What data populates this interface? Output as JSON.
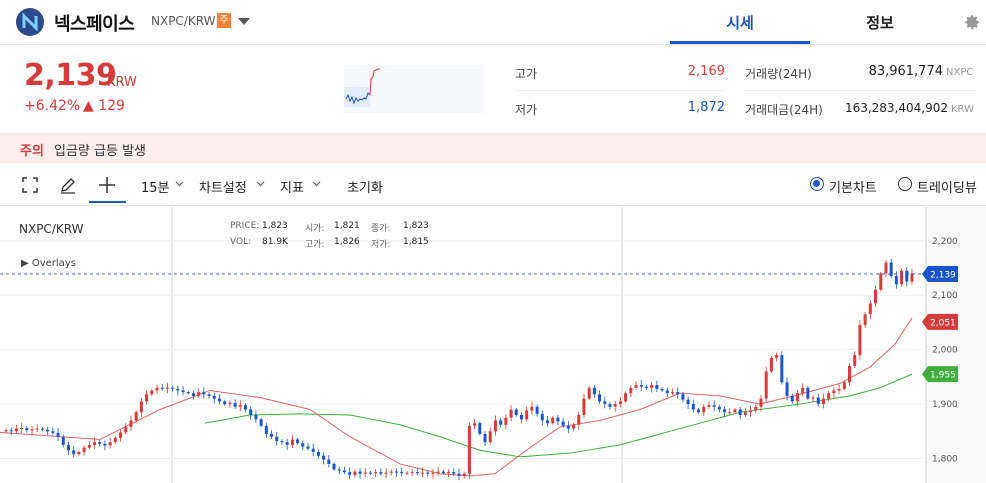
{
  "header": {
    "coin_name": "넥스페이스",
    "pair": "NXPC/KRW",
    "warning_badge": "주",
    "tabs": [
      {
        "label": "시세"
      },
      {
        "label": "정보"
      }
    ]
  },
  "summary": {
    "price": "2,139",
    "price_unit": "KRW",
    "change_pct": "+6.42%",
    "change_abs": "▲ 129",
    "high_label": "고가",
    "high_value": "2,169",
    "low_label": "저가",
    "low_value": "1,872",
    "volume_label": "거래량(24H)",
    "volume_value": "83,961,774",
    "volume_unit": "NXPC",
    "amount_label": "거래대금(24H)",
    "amount_value": "163,283,404,902",
    "amount_unit": "KRW"
  },
  "notice": {
    "tag": "주의",
    "text": "입금량 급등 발생"
  },
  "toolbar": {
    "interval": "15분",
    "chart_settings": "차트설정",
    "indicators": "지표",
    "reset": "초기화",
    "basic_chart": "기본차트",
    "tradingview": "트레이딩뷰"
  },
  "chart_info": {
    "pair": "NXPC/KRW",
    "overlays": "Overlays",
    "price_label": "PRICE:",
    "price": "1,823",
    "open_label": "시가:",
    "open": "1,821",
    "close_label": "종가:",
    "close": "1,823",
    "vol_label": "VOL:",
    "vol": "81.9K",
    "high_label": "고가:",
    "high": "1,826",
    "low_label": "저가:",
    "low": "1,815"
  },
  "chart_data": {
    "type": "candlestick",
    "y_ticks": [
      "2,200",
      "2,100",
      "2,000",
      "1,900",
      "1,800"
    ],
    "y_tick_values": [
      2200,
      2100,
      2000,
      1900,
      1800
    ],
    "ylim": [
      1755,
      2262
    ],
    "price_tags": [
      {
        "label": "2,139",
        "value": 2139,
        "color": "#1a55c9"
      },
      {
        "label": "2,051",
        "value": 2051,
        "color": "#d43b3b"
      },
      {
        "label": "1,955",
        "value": 1955,
        "color": "#3fae3f"
      }
    ],
    "closes": [
      1852,
      1850,
      1855,
      1856,
      1852,
      1854,
      1855,
      1853,
      1850,
      1847,
      1840,
      1825,
      1815,
      1808,
      1812,
      1820,
      1825,
      1830,
      1827,
      1824,
      1830,
      1838,
      1848,
      1858,
      1870,
      1885,
      1905,
      1918,
      1925,
      1930,
      1928,
      1930,
      1928,
      1925,
      1922,
      1920,
      1915,
      1922,
      1918,
      1915,
      1910,
      1905,
      1900,
      1902,
      1895,
      1898,
      1890,
      1880,
      1872,
      1860,
      1845,
      1840,
      1832,
      1830,
      1825,
      1835,
      1828,
      1822,
      1818,
      1812,
      1805,
      1798,
      1790,
      1780,
      1778,
      1775,
      1770,
      1776,
      1772,
      1774,
      1773,
      1775,
      1772,
      1774,
      1776,
      1775,
      1773,
      1774,
      1775,
      1773,
      1774,
      1772,
      1774,
      1776,
      1773,
      1775,
      1772,
      1768,
      1772,
      1860,
      1865,
      1845,
      1830,
      1850,
      1870,
      1862,
      1875,
      1890,
      1880,
      1872,
      1888,
      1895,
      1882,
      1870,
      1865,
      1875,
      1868,
      1860,
      1855,
      1862,
      1880,
      1910,
      1930,
      1918,
      1905,
      1900,
      1895,
      1900,
      1905,
      1920,
      1930,
      1935,
      1932,
      1930,
      1935,
      1928,
      1925,
      1920,
      1922,
      1918,
      1908,
      1900,
      1890,
      1885,
      1895,
      1898,
      1895,
      1890,
      1885,
      1885,
      1890,
      1880,
      1885,
      1888,
      1895,
      1910,
      1960,
      1985,
      1990,
      1940,
      1915,
      1905,
      1920,
      1930,
      1910,
      1912,
      1900,
      1910,
      1920,
      1925,
      1928,
      1940,
      1970,
      1990,
      2045,
      2065,
      2085,
      2110,
      2140,
      2160,
      2135,
      2120,
      2145,
      2125,
      2140
    ],
    "sma_short": [
      [
        0,
        1848
      ],
      [
        100,
        1835
      ],
      [
        160,
        1890
      ],
      [
        210,
        1925
      ],
      [
        260,
        1912
      ],
      [
        310,
        1890
      ],
      [
        350,
        1840
      ],
      [
        400,
        1790
      ],
      [
        440,
        1772
      ],
      [
        470,
        1768
      ],
      [
        495,
        1772
      ],
      [
        530,
        1820
      ],
      [
        560,
        1858
      ],
      [
        600,
        1870
      ],
      [
        640,
        1890
      ],
      [
        680,
        1920
      ],
      [
        720,
        1915
      ],
      [
        760,
        1900
      ],
      [
        800,
        1918
      ],
      [
        840,
        1938
      ],
      [
        870,
        1968
      ],
      [
        895,
        2010
      ],
      [
        912,
        2058
      ]
    ],
    "sma_long": [
      [
        205,
        1865
      ],
      [
        250,
        1880
      ],
      [
        300,
        1882
      ],
      [
        350,
        1880
      ],
      [
        400,
        1862
      ],
      [
        440,
        1840
      ],
      [
        480,
        1815
      ],
      [
        520,
        1803
      ],
      [
        570,
        1810
      ],
      [
        620,
        1825
      ],
      [
        680,
        1855
      ],
      [
        740,
        1885
      ],
      [
        800,
        1900
      ],
      [
        850,
        1915
      ],
      [
        880,
        1930
      ],
      [
        912,
        1955
      ]
    ]
  }
}
